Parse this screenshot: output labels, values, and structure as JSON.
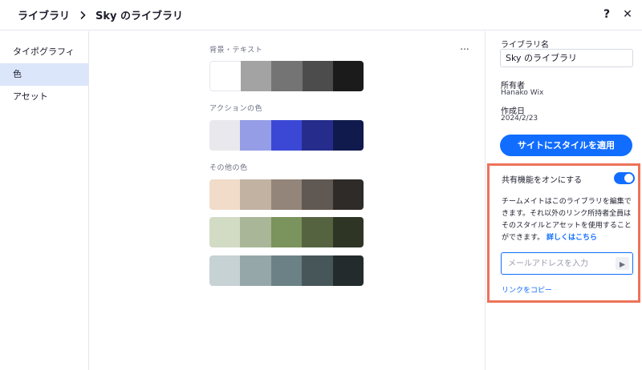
{
  "header": {
    "breadcrumb_root": "ライブラリ",
    "breadcrumb_current": "Sky のライブラリ",
    "help_label": "?",
    "close_label": "✕"
  },
  "sidebar": {
    "items": [
      {
        "label": "タイポグラフィ",
        "active": false
      },
      {
        "label": "色",
        "active": true
      },
      {
        "label": "アセット",
        "active": false
      }
    ]
  },
  "main": {
    "more_label": "...",
    "sections": [
      {
        "title": "背景・テキスト",
        "palettes": [
          [
            "#ffffff",
            "#a3a3a3",
            "#747474",
            "#4c4c4c",
            "#1b1b1b"
          ]
        ]
      },
      {
        "title": "アクションの色",
        "palettes": [
          [
            "#e8e8ed",
            "#959de6",
            "#3b48d6",
            "#262c8c",
            "#111a4d"
          ]
        ]
      },
      {
        "title": "その他の色",
        "palettes": [
          [
            "#f1dcca",
            "#c1b2a1",
            "#938579",
            "#605852",
            "#2f2b28"
          ],
          [
            "#d2dbc4",
            "#a9b798",
            "#7b935c",
            "#566341",
            "#2e3525"
          ],
          [
            "#c6d2d4",
            "#96a7aa",
            "#6b8185",
            "#465659",
            "#232b2c"
          ]
        ]
      }
    ]
  },
  "panel": {
    "library_name_label": "ライブラリ名",
    "library_name_value": "Sky のライブラリ",
    "owner_label": "所有者",
    "owner_value": "Hanako Wix",
    "created_label": "作成日",
    "created_value": "2024/2/23",
    "apply_button": "サイトにスタイルを適用",
    "sharing": {
      "title": "共有機能をオンにする",
      "enabled": true,
      "description": "チームメイトはこのライブラリを編集できます。それ以外のリンク所持者全員はそのスタイルとアセットを使用することができます。",
      "learn_more": "詳しくはこちら",
      "email_placeholder": "メールアドレスを入力",
      "copy_link": "リンクをコピー"
    }
  },
  "colors": {
    "accent": "#116dff",
    "highlight_border": "#ec735a",
    "sidebar_active": "#dbe6fb"
  }
}
